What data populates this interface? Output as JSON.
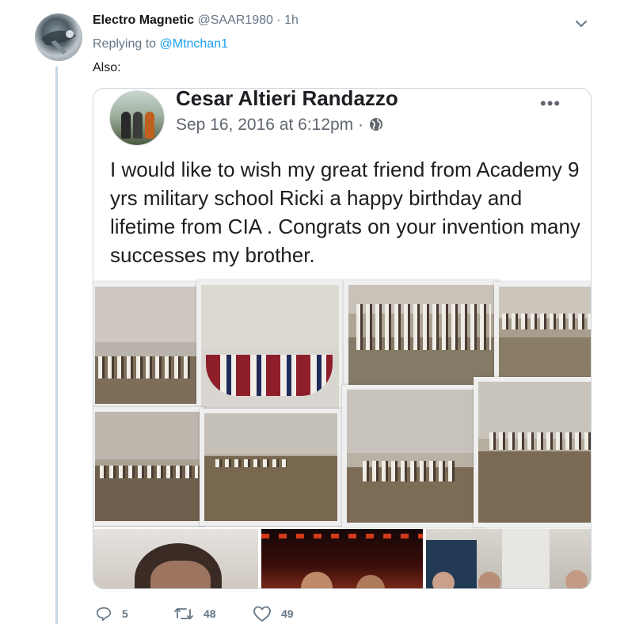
{
  "tweet": {
    "author_name": "Electro Magnetic",
    "author_handle": "@SAAR1980",
    "separator": "·",
    "time": "1h",
    "replying_prefix": "Replying to",
    "replying_to": "@Mtnchan1",
    "text": "Also:"
  },
  "embedded_post": {
    "name": "Cesar Altieri Randazzo",
    "date": "Sep 16, 2016 at 6:12pm",
    "meta_separator": "·",
    "more": "•••",
    "text": "I would like to wish my great friend from Academy 9 yrs military school Ricki a happy birthday and lifetime from CIA . Congrats on your invention many successes my brother."
  },
  "actions": {
    "replies": "5",
    "retweets": "48",
    "likes": "49"
  },
  "colors": {
    "link": "#1da1f2",
    "muted": "#657786",
    "thread_line": "#c4d6e6",
    "border": "#ccd6dd"
  },
  "icons": [
    "chevron-down-icon",
    "globe-icon",
    "reply-icon",
    "retweet-icon",
    "heart-icon"
  ]
}
